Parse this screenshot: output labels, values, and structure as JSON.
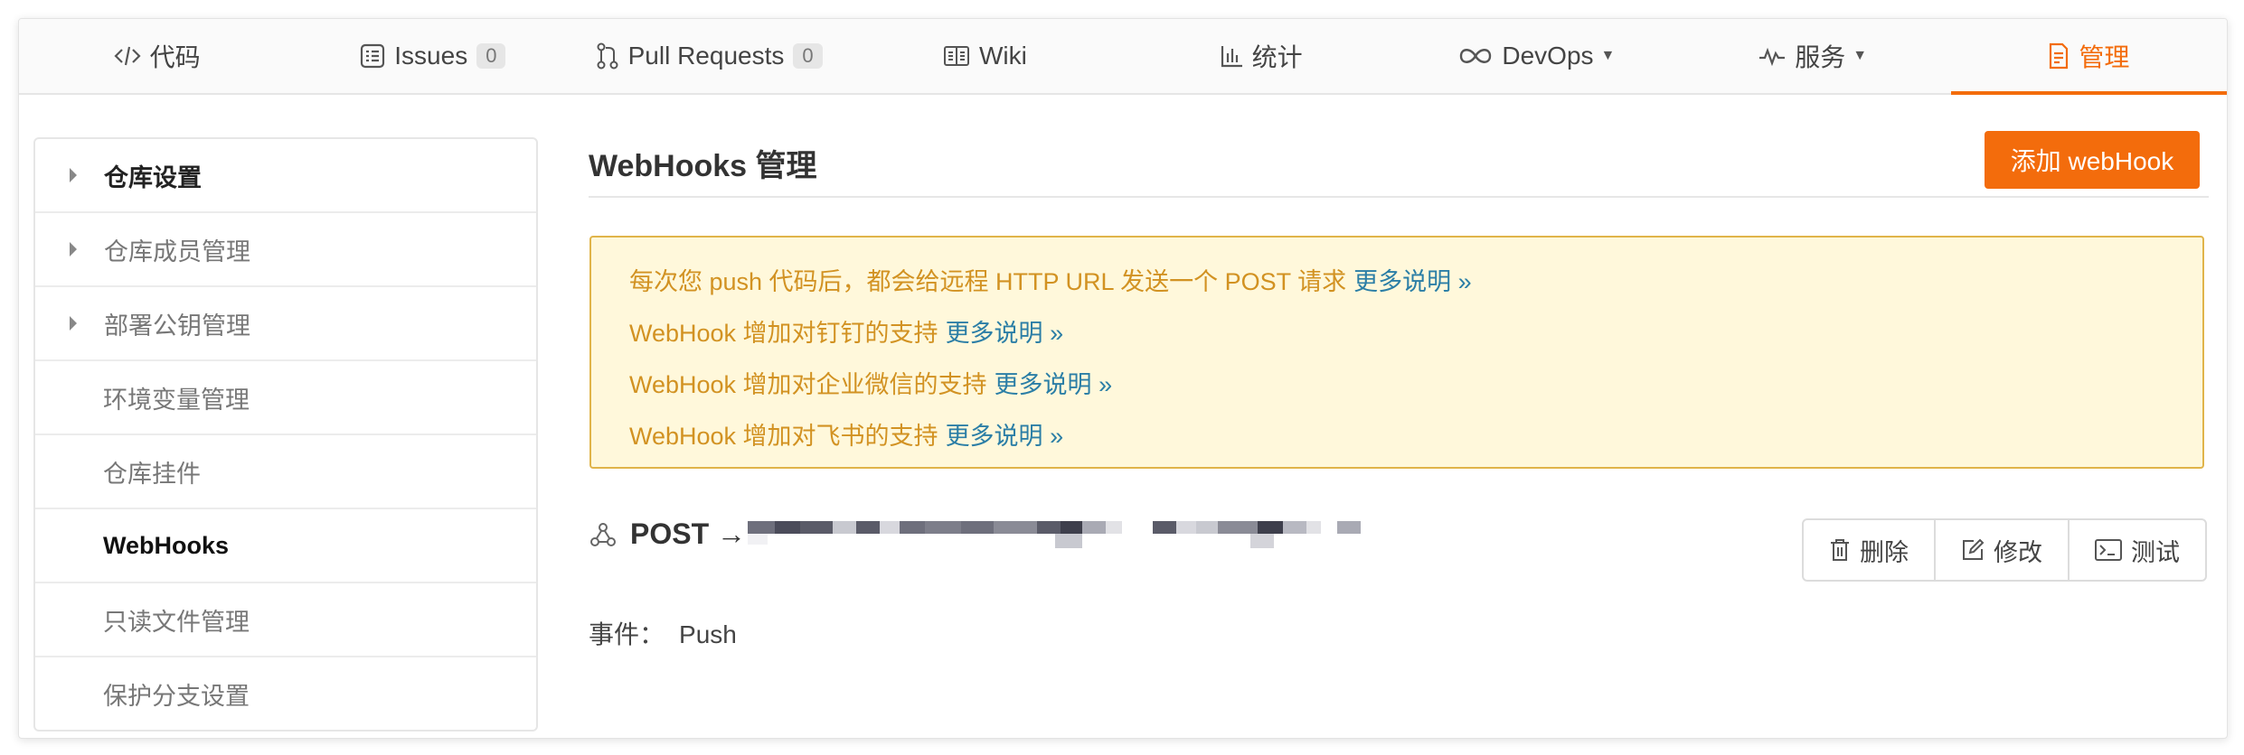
{
  "tabs": [
    {
      "label": "代码",
      "icon": "code-icon"
    },
    {
      "label": "Issues",
      "icon": "issues-icon",
      "count": "0"
    },
    {
      "label": "Pull Requests",
      "icon": "pull-request-icon",
      "count": "0"
    },
    {
      "label": "Wiki",
      "icon": "book-icon"
    },
    {
      "label": "统计",
      "icon": "bar-chart-icon"
    },
    {
      "label": "DevOps",
      "icon": "infinity-icon",
      "dropdown": true
    },
    {
      "label": "服务",
      "icon": "pulse-icon",
      "dropdown": true
    },
    {
      "label": "管理",
      "icon": "document-icon",
      "active": true
    }
  ],
  "sidebar": {
    "items": [
      {
        "label": "仓库设置"
      },
      {
        "label": "仓库成员管理"
      },
      {
        "label": "部署公钥管理"
      },
      {
        "label": "环境变量管理"
      },
      {
        "label": "仓库挂件"
      },
      {
        "label": "WebHooks",
        "active": true
      },
      {
        "label": "只读文件管理"
      },
      {
        "label": "保护分支设置"
      }
    ]
  },
  "main": {
    "title": "WebHooks 管理",
    "add_button": "添加 webHook",
    "notice": {
      "lines": [
        {
          "text": "每次您 push 代码后，都会给远程 HTTP URL 发送一个 POST 请求",
          "link": "更多说明 »"
        },
        {
          "text": "WebHook 增加对钉钉的支持",
          "link": "更多说明 »"
        },
        {
          "text": "WebHook 增加对企业微信的支持",
          "link": "更多说明 »"
        },
        {
          "text": "WebHook 增加对飞书的支持",
          "link": "更多说明 »"
        }
      ]
    },
    "hook": {
      "method": "POST →",
      "actions": {
        "delete": "删除",
        "edit": "修改",
        "test": "测试"
      },
      "events_label": "事件：",
      "events_value": "Push"
    }
  },
  "colors": {
    "accent": "#f36c0c",
    "notice_bg": "#fff8db",
    "notice_text": "#d29222",
    "link": "#2b7ea6"
  }
}
